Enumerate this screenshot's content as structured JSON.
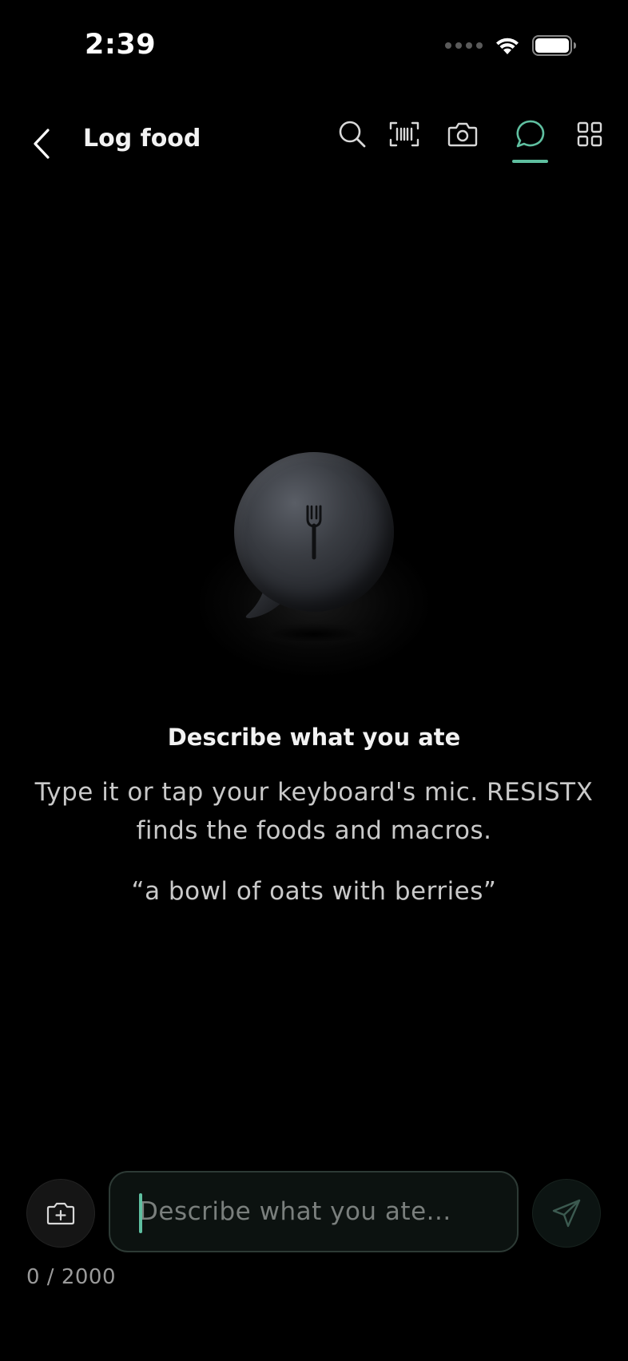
{
  "status_bar": {
    "time": "2:39",
    "icons": [
      "cellular-signal-icon",
      "wifi-icon",
      "battery-icon"
    ]
  },
  "header": {
    "back_icon": "chevron-left-icon",
    "title": "Log food",
    "tabs": [
      {
        "name": "search",
        "icon": "search-icon",
        "active": false
      },
      {
        "name": "barcode",
        "icon": "barcode-scan-icon",
        "active": false
      },
      {
        "name": "camera",
        "icon": "camera-icon",
        "active": false
      },
      {
        "name": "chat",
        "icon": "chat-bubble-icon",
        "active": true
      },
      {
        "name": "grid",
        "icon": "grid-icon",
        "active": false
      }
    ]
  },
  "empty_state": {
    "illustration": "chat-bubble-fork-illustration",
    "title": "Describe what you ate",
    "description": "Type it or tap your keyboard's mic. RESISTX finds the foods and macros.",
    "example": "“a bowl of oats with berries”"
  },
  "composer": {
    "placeholder": "Describe what you ate...",
    "value": "",
    "char_count": "0 / 2000",
    "add_photo_icon": "add-photo-icon",
    "send_icon": "send-icon"
  },
  "colors": {
    "background": "#000000",
    "accent": "#5fbfa0",
    "text_primary": "#f2f2f2",
    "text_secondary": "#c9c9c9"
  }
}
